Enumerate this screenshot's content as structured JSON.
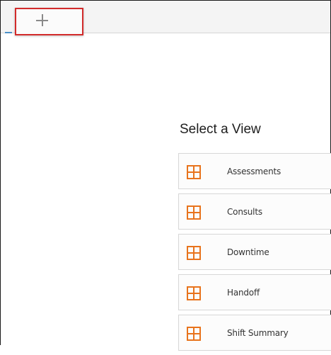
{
  "toolbar": {
    "add_tab_icon": "plus-icon"
  },
  "main": {
    "title": "Select a View",
    "views": [
      {
        "label": "Assessments",
        "icon": "grid-icon"
      },
      {
        "label": "Consults",
        "icon": "grid-icon"
      },
      {
        "label": "Downtime",
        "icon": "grid-icon"
      },
      {
        "label": "Handoff",
        "icon": "grid-icon"
      },
      {
        "label": "Shift Summary",
        "icon": "grid-icon"
      }
    ]
  },
  "colors": {
    "accent_orange": "#e8731c",
    "highlight_red": "#d22b2b",
    "tab_indicator_blue": "#4a90c8"
  }
}
